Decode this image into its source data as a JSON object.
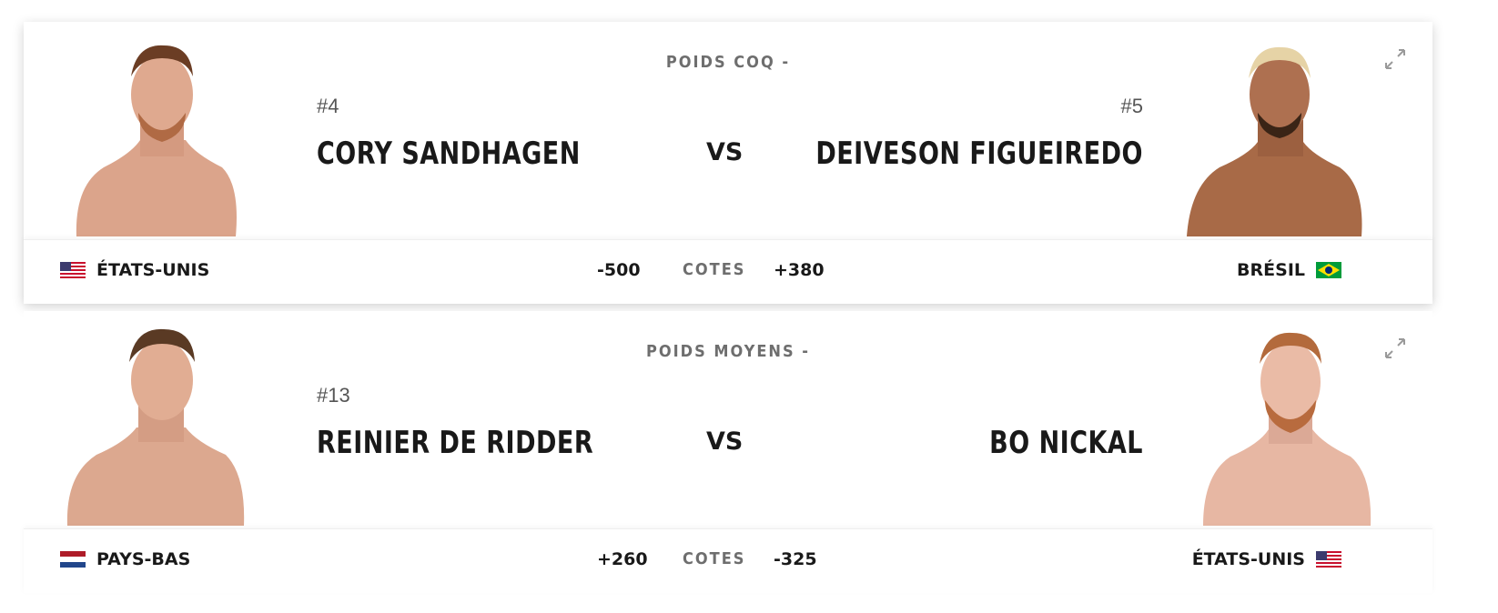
{
  "fights": [
    {
      "weight_class": "POIDS COQ -",
      "odds_label": "COTES",
      "red": {
        "rank": "#4",
        "name": "CORY SANDHAGEN",
        "country": "ÉTATS-UNIS",
        "odds": "-500",
        "flag": "us-flag-icon"
      },
      "vs": "VS",
      "blue": {
        "rank": "#5",
        "name": "DEIVESON FIGUEIREDO",
        "country": "BRÉSIL",
        "odds": "+380",
        "flag": "brazil-flag-icon"
      }
    },
    {
      "weight_class": "POIDS MOYENS -",
      "odds_label": "COTES",
      "red": {
        "rank": "#13",
        "name": "REINIER DE RIDDER",
        "country": "PAYS-BAS",
        "odds": "+260",
        "flag": "netherlands-flag-icon"
      },
      "vs": "VS",
      "blue": {
        "rank": "",
        "name": "BO NICKAL",
        "country": "ÉTATS-UNIS",
        "odds": "-325",
        "flag": "us-flag-icon"
      }
    }
  ],
  "colors": {
    "text": "#191919",
    "muted": "#6e6e6e",
    "skin": "#d9a48a",
    "dark_skin": "#a86a47"
  }
}
